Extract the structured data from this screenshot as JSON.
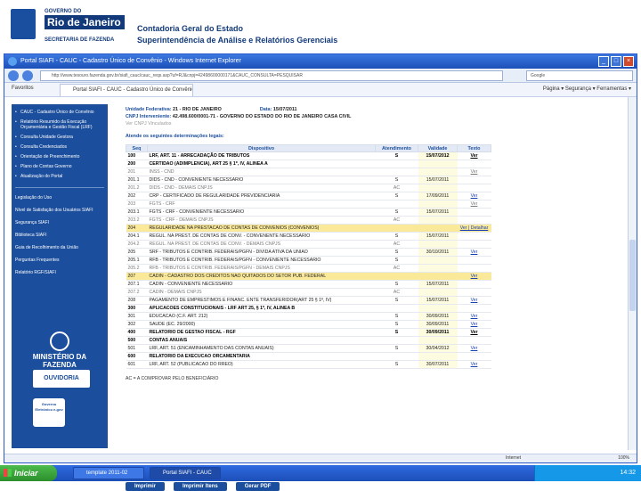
{
  "slide": {
    "logo_line1": "GOVERNO DO",
    "logo_line2": "Rio de Janeiro",
    "logo_line3": "SECRETARIA DE FAZENDA",
    "title1": "Contadoria Geral do Estado",
    "title2": "Superintendência de Análise e Relatórios Gerenciais"
  },
  "browser": {
    "window_title": "Portal SIAFI - CAUC - Cadastro Único de Convênio - Windows Internet Explorer",
    "address": "http://www.tesouro.fazenda.gov.br/siafi_cauc/cauc_reqs.asp?uf=RJ&cnpj=42498600000171&CAUC_CONSULTA=PESQUISAR",
    "search_placeholder": "Google",
    "favorites": "Favoritos",
    "tab_label": "Portal SIAFI - CAUC - Cadastro Único de Convênio",
    "tools": "Página ▾  Segurança ▾  Ferramentas ▾",
    "status_zone": "Internet",
    "status_zoom": "100%"
  },
  "sidebar": {
    "items": [
      "CAUC - Cadastro Único de Convênio",
      "Relatório Resumido da Execução Orçamentária e Gestão Fiscal (LRF)",
      "Consulta Unidade Gestora",
      "Consulta Credenciados",
      "Orientação de Preenchimento",
      "Plano de Contas Governo",
      "Atualização do Portal"
    ],
    "links": [
      "Legislação do Uso",
      "Nível de Satisfação dos Usuários SIAFI",
      "Segurança SIAFI",
      "Biblioteca SIAFI",
      "Guia de Recolhimento da União",
      "Perguntas Frequentes",
      "Relatório RGF/SIAFI"
    ],
    "logo_ministerio": "MINISTÉRIO DA FAZENDA",
    "logo_ouvidoria": "OUVIDORIA",
    "logo_egov": "Governo Eletrônico e-gov"
  },
  "main": {
    "uf_label": "Unidade Federativa:",
    "uf_value": "21 - RIO DE JANEIRO",
    "date_label": "Data:",
    "date_value": "15/07/2011",
    "cnpj_label": "CNPJ Interveniente:",
    "cnpj_value": "42.498.600/0001-71 - GOVERNO DO ESTADO DO RIO DE JANEIRO CASA CIVIL",
    "ver_vinculados": "Ver CNPJ Vinculados",
    "heading": "Atende os seguintes determinações legais:",
    "columns": [
      "Seq",
      "Dispositivo",
      "Atendimento",
      "Validade",
      "Texto"
    ],
    "rows": [
      {
        "seq": "100",
        "disp": "LRF, ART. 11 - ARRECADAÇÃO DE TRIBUTOS",
        "at": "S",
        "val": "15/07/2012",
        "txt": "Ver",
        "style": "bold"
      },
      {
        "seq": "200",
        "disp": "CERTIDAO (ADIMPLENCIA), ART 25 § 1º, IV, ALINEA A",
        "at": "",
        "val": "",
        "txt": "",
        "style": "bold"
      },
      {
        "seq": "201",
        "disp": "INSS - CND",
        "at": "",
        "val": "",
        "txt": "Ver",
        "style": "dim"
      },
      {
        "seq": "201.1",
        "disp": "DIDS - CND - CONVENIENTE NECESSARIO",
        "at": "S",
        "val": "15/07/2011",
        "txt": "",
        "style": ""
      },
      {
        "seq": "201.2",
        "disp": "DIDS - CND - DEMAIS CNPJS",
        "at": "AC",
        "val": "",
        "txt": "",
        "style": "dim"
      },
      {
        "seq": "202",
        "disp": "CRP - CERTIFICADO DE REGULARIDADE PREVIDENCIARIA",
        "at": "S",
        "val": "17/09/2011",
        "txt": "Ver",
        "style": ""
      },
      {
        "seq": "203",
        "disp": "FGTS - CRF",
        "at": "",
        "val": "",
        "txt": "Ver",
        "style": "dim"
      },
      {
        "seq": "203.1",
        "disp": "FGTS - CRF - CONVENIENTE NECESSARIO",
        "at": "S",
        "val": "15/07/2011",
        "txt": "",
        "style": ""
      },
      {
        "seq": "203.2",
        "disp": "FGTS - CRF - DEMAIS CNPJS",
        "at": "AC",
        "val": "",
        "txt": "",
        "style": "dim"
      },
      {
        "seq": "204",
        "disp": "REGULARIDADE NA PRESTACAO DE CONTAS DE CONVENIOS (CONVENIOS)",
        "at": "",
        "val": "",
        "txt": "Ver | Detalhar",
        "style": "hl"
      },
      {
        "seq": "204.1",
        "disp": "REGUL. NA PREST. DE CONTAS DE CONV. - CONVENENTE NECESSARIO",
        "at": "S",
        "val": "15/07/2011",
        "txt": "",
        "style": ""
      },
      {
        "seq": "204.2",
        "disp": "REGUL. NA PREST. DE CONTAS DE CONV. - DEMAIS CNPJS",
        "at": "AC",
        "val": "",
        "txt": "",
        "style": "dim"
      },
      {
        "seq": "205",
        "disp": "SRF - TRIBUTOS E CONTRIB. FEDERAIS/PGFN - DIVIDA ATIVA DA UNIAO",
        "at": "S",
        "val": "30/10/2011",
        "txt": "Ver",
        "style": ""
      },
      {
        "seq": "205.1",
        "disp": "RFB - TRIBUTOS E CONTRIB. FEDERAIS/PGFN - CONVENIENTE NECESSARIO",
        "at": "S",
        "val": "",
        "txt": "",
        "style": ""
      },
      {
        "seq": "205.2",
        "disp": "RFB - TRIBUTOS E CONTRIB. FEDERAIS/PGFN - DEMAIS CNPJS",
        "at": "AC",
        "val": "",
        "txt": "",
        "style": "dim"
      },
      {
        "seq": "207",
        "disp": "CADIN - CADASTRO DOS CREDITOS NAO QUITADOS DO SETOR PUB. FEDERAL",
        "at": "",
        "val": "",
        "txt": "Ver",
        "style": "hl"
      },
      {
        "seq": "207.1",
        "disp": "CADIN - CONVENIENTE NECESSARIO",
        "at": "S",
        "val": "15/07/2011",
        "txt": "",
        "style": ""
      },
      {
        "seq": "207.2",
        "disp": "CADIN - DEMAIS CNPJS",
        "at": "AC",
        "val": "",
        "txt": "",
        "style": "dim"
      },
      {
        "seq": "208",
        "disp": "PAGAMENTO DE EMPRESTIMOS E FINANC. ENTE TRANSFERIDOR(ART 25 § 1º, IV)",
        "at": "S",
        "val": "15/07/2011",
        "txt": "Ver",
        "style": ""
      },
      {
        "seq": "300",
        "disp": "APLICACOES CONSTITUCIONAIS - LRF ART 25, § 1º, IV, ALINEA B",
        "at": "",
        "val": "",
        "txt": "",
        "style": "bold"
      },
      {
        "seq": "301",
        "disp": "EDUCACAO (C.F. ART. 212)",
        "at": "S",
        "val": "30/09/2011",
        "txt": "Ver",
        "style": ""
      },
      {
        "seq": "302",
        "disp": "SAUDE (EC. 29/2000)",
        "at": "S",
        "val": "30/09/2011",
        "txt": "Ver",
        "style": ""
      },
      {
        "seq": "400",
        "disp": "RELATORIO DE GESTAO FISCAL - RGF",
        "at": "S",
        "val": "30/09/2011",
        "txt": "Ver",
        "style": "bold"
      },
      {
        "seq": "500",
        "disp": "CONTAS ANUAIS",
        "at": "",
        "val": "",
        "txt": "",
        "style": "bold"
      },
      {
        "seq": "501",
        "disp": "LRF, ART. 51 (ENCAMINHAMENTO DAS CONTAS ANUAIS)",
        "at": "S",
        "val": "30/04/2012",
        "txt": "Ver",
        "style": ""
      },
      {
        "seq": "600",
        "disp": "RELATORIO DA EXECUCAO ORCAMENTARIA",
        "at": "",
        "val": "",
        "txt": "",
        "style": "bold"
      },
      {
        "seq": "601",
        "disp": "LRF, ART. 52 (PUBLICACAO DO RREO)",
        "at": "S",
        "val": "30/07/2011",
        "txt": "Ver",
        "style": ""
      }
    ],
    "legend": "AC = A COMPROVAR PELO BENEFICIÁRIO",
    "btn_print": "Imprimir",
    "btn_print_items": "Imprimir Itens",
    "btn_pdf": "Gerar PDF"
  },
  "taskbar": {
    "start": "Iniciar",
    "task1": "template 2011-02",
    "task2": "Portal SIAFI - CAUC",
    "clock": "14:32"
  }
}
